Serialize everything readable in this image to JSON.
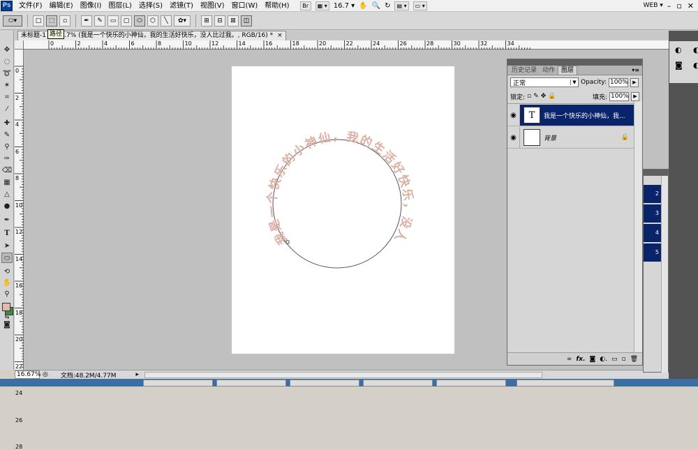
{
  "app": {
    "logo": "Ps"
  },
  "menu": [
    "文件(F)",
    "编辑(E)",
    "图像(I)",
    "图层(L)",
    "选择(S)",
    "滤镜(T)",
    "视图(V)",
    "窗口(W)",
    "帮助(H)"
  ],
  "menubar_right": {
    "br_label": "Br",
    "zoom_level": "16.7",
    "workspace": "WEB"
  },
  "tooltip": "路径",
  "document": {
    "tab_title": "未标题-1 @ 16.7% (我是一个快乐的小神仙，我的生活好快乐，没人比过我。, RGB/16) *",
    "tab_close": "×",
    "circle_text": "我是一个快乐的小神仙，我的生活好快乐，没人比过我。"
  },
  "ruler_top": [
    "0",
    "2",
    "4",
    "6",
    "8",
    "10",
    "12",
    "14",
    "16",
    "18",
    "20",
    "22",
    "24",
    "26",
    "28",
    "30",
    "32",
    "34"
  ],
  "ruler_left": [
    "0",
    "2",
    "4",
    "6",
    "8",
    "10",
    "12",
    "14",
    "16",
    "18",
    "20",
    "22",
    "24",
    "26",
    "28"
  ],
  "status": {
    "zoom": "16.67%",
    "doc_size": "文档:48.2M/4.77M"
  },
  "layers_panel": {
    "tabs": [
      "历史记录",
      "动作",
      "图层"
    ],
    "blend_mode": "正常",
    "opacity_label": "Opacity:",
    "opacity_value": "100%",
    "lock_label": "锁定:",
    "fill_label": "填充:",
    "fill_value": "100%",
    "layers": [
      {
        "name": "我是一个快乐的小神仙，我...",
        "thumb": "T",
        "selected": true
      },
      {
        "name": "背景",
        "thumb": "",
        "selected": false
      }
    ],
    "footer_icons": [
      "link-icon",
      "fx-icon",
      "mask-icon",
      "adjustment-icon",
      "group-icon",
      "new-layer-icon",
      "trash-icon"
    ]
  },
  "mini_panel": {
    "items": [
      "2",
      "3",
      "4",
      "5"
    ]
  },
  "colors": {
    "text_on_path": "#dcb0a4",
    "foreground": "#e8b8b0",
    "background": "#3e8e3e",
    "selection": "#0a246a"
  }
}
